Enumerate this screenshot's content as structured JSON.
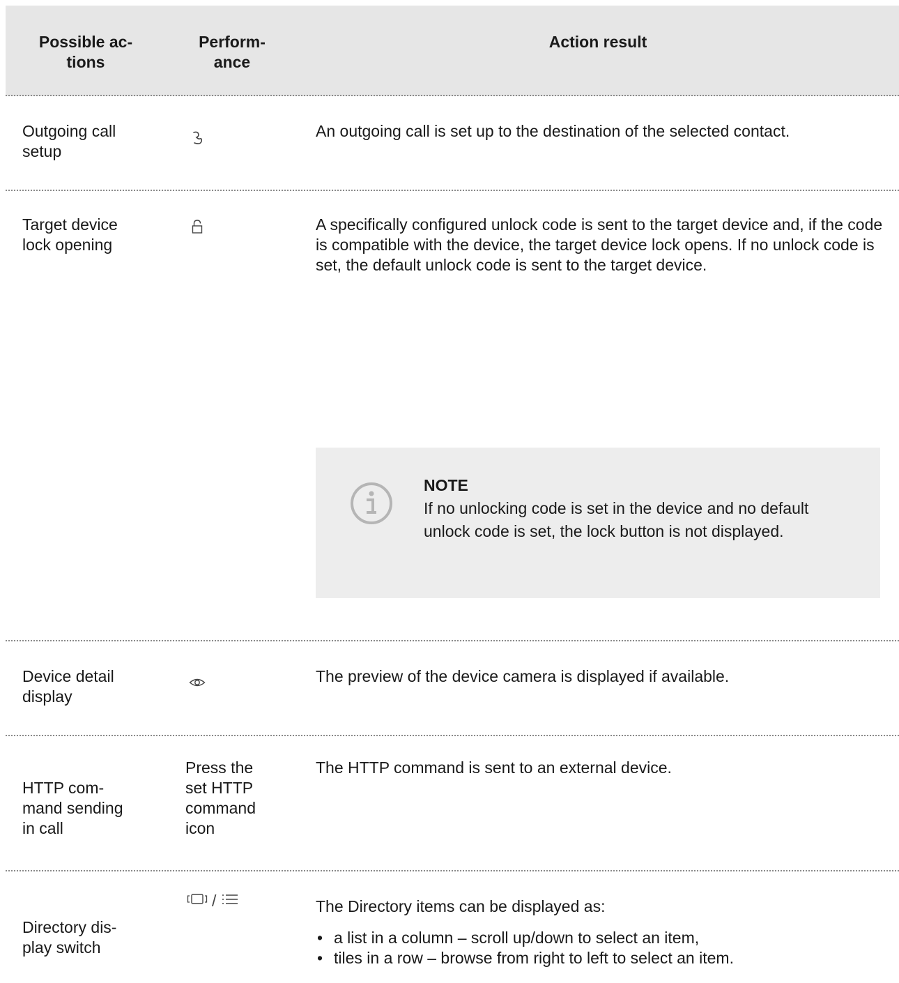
{
  "table": {
    "headers": {
      "col1": "Possible ac-\ntions",
      "col2": "Perform-\nance",
      "col3": "Action result"
    },
    "rows": [
      {
        "action": "Outgoing call setup",
        "performance_icon": "phone-handset-icon",
        "result": "An outgoing call is set up to the destination of the selected contact."
      },
      {
        "action": "Target device lock opening",
        "performance_icon": "lock-icon",
        "result": "A specifically configured unlock code is sent to the target device and, if the code is compatible with the device, the target device lock opens. If no unlock code is set, the default unlock code is sent to the target device.",
        "note": {
          "icon": "info-icon",
          "title": "NOTE",
          "text": "If no unlocking code is set in the device and no default unlock code is set, the lock button is not displayed."
        }
      },
      {
        "action": "Device detail display",
        "performance_icon": "eye-icon",
        "result": "The preview of the device camera is displayed if available."
      },
      {
        "action": "HTTP com-\nmand sending\nin call",
        "performance": "Press the\nset HTTP\ncommand\nicon",
        "result": "The HTTP command is sent to an external device."
      },
      {
        "action": "Directory dis-\nplay switch",
        "performance_icons": [
          "tiles-view-icon",
          "list-view-icon"
        ],
        "performance_separator": "/",
        "result": "The Directory items can be displayed as:",
        "bullets": [
          "a list in a column – scroll up/down to select an item,",
          "tiles in a row – browse from right to left to select an item."
        ]
      }
    ]
  }
}
